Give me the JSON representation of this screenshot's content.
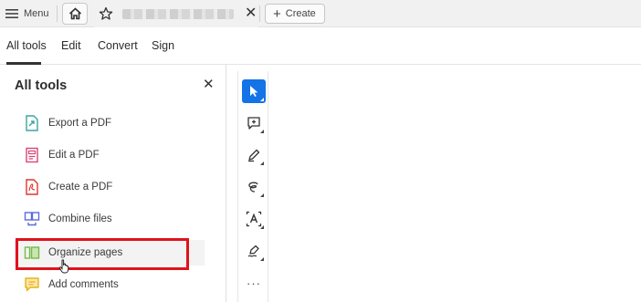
{
  "tabbar": {
    "menu_label": "Menu",
    "create_label": "Create",
    "doc_title_hidden": true
  },
  "nav": {
    "tabs": [
      {
        "label": "All tools",
        "active": true
      },
      {
        "label": "Edit",
        "active": false
      },
      {
        "label": "Convert",
        "active": false
      },
      {
        "label": "Sign",
        "active": false
      }
    ]
  },
  "panel": {
    "title": "All tools",
    "tools": [
      {
        "label": "Export a PDF",
        "icon": "export-pdf-icon",
        "color": "#3aa6a0"
      },
      {
        "label": "Edit a PDF",
        "icon": "edit-pdf-icon",
        "color": "#d8457a"
      },
      {
        "label": "Create a PDF",
        "icon": "create-pdf-icon",
        "color": "#e0362c"
      },
      {
        "label": "Combine files",
        "icon": "combine-files-icon",
        "color": "#5b6bd8"
      },
      {
        "label": "Organize pages",
        "icon": "organize-pages-icon",
        "color": "#76b947",
        "highlighted": true
      },
      {
        "label": "Add comments",
        "icon": "add-comments-icon",
        "color": "#e8b21c"
      }
    ]
  },
  "toolbar": {
    "tools": [
      {
        "name": "select-tool",
        "active": true
      },
      {
        "name": "add-comment-tool",
        "active": false
      },
      {
        "name": "highlight-tool",
        "active": false
      },
      {
        "name": "draw-tool",
        "active": false
      },
      {
        "name": "text-tool",
        "active": false
      },
      {
        "name": "sign-tool",
        "active": false
      },
      {
        "name": "more-tools",
        "active": false
      }
    ],
    "more_label": "···"
  },
  "colors": {
    "accent": "#1473e6",
    "annotation": "#e0121b"
  }
}
